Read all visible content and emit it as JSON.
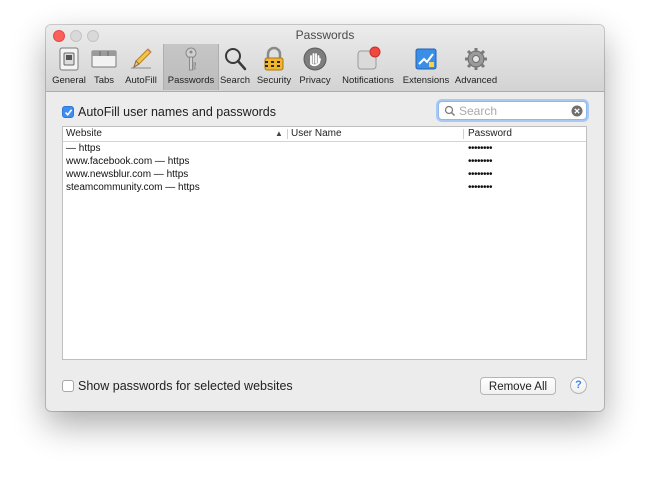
{
  "window": {
    "title": "Passwords"
  },
  "toolbar": {
    "items": [
      {
        "label": "General",
        "icon": "general-switch-icon"
      },
      {
        "label": "Tabs",
        "icon": "tabs-icon"
      },
      {
        "label": "AutoFill",
        "icon": "autofill-pencil-icon"
      },
      {
        "label": "Passwords",
        "icon": "key-icon",
        "active": true
      },
      {
        "label": "Search",
        "icon": "magnifier-icon"
      },
      {
        "label": "Security",
        "icon": "lock-icon"
      },
      {
        "label": "Privacy",
        "icon": "hand-icon"
      },
      {
        "label": "Notifications",
        "icon": "notification-badge-icon"
      },
      {
        "label": "Extensions",
        "icon": "puzzle-icon"
      },
      {
        "label": "Advanced",
        "icon": "gear-icon"
      }
    ]
  },
  "autofill": {
    "label": "AutoFill user names and passwords",
    "checked": true
  },
  "search": {
    "placeholder": "Search",
    "value": ""
  },
  "table": {
    "columns": {
      "website": "Website",
      "user_name": "User Name",
      "password": "Password"
    },
    "rows": [
      {
        "website": " — https",
        "user_name": "",
        "password": "••••••••"
      },
      {
        "website": "www.facebook.com — https",
        "user_name": "",
        "password": "••••••••"
      },
      {
        "website": "www.newsblur.com — https",
        "user_name": "",
        "password": "••••••••"
      },
      {
        "website": "steamcommunity.com — https",
        "user_name": "",
        "password": "••••••••"
      }
    ]
  },
  "footer": {
    "show_passwords_label": "Show passwords for selected websites",
    "show_passwords_checked": false,
    "remove_all_label": "Remove All",
    "help_label": "?"
  },
  "colors": {
    "accent": "#3d8df5",
    "close": "#fc605c"
  }
}
